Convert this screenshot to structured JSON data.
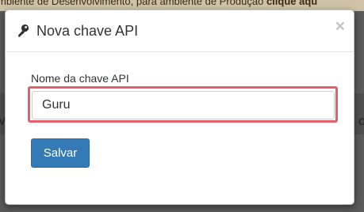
{
  "backdrop": {
    "banner_text": "mbiente de Desenvolvimento, para ambiente de Produção ",
    "banner_link": "clique aqu",
    "left_edge_glyph": "M",
    "right_edge_glyph": "o"
  },
  "modal": {
    "title": "Nova chave API",
    "title_icon": "key-icon",
    "close_label": "×",
    "field": {
      "label": "Nome da chave API",
      "value": "Guru",
      "placeholder": ""
    },
    "save_label": "Salvar"
  },
  "colors": {
    "primary_button": "#337ab7",
    "highlight_border": "#e5606a",
    "banner_background": "#cfc2a7"
  }
}
